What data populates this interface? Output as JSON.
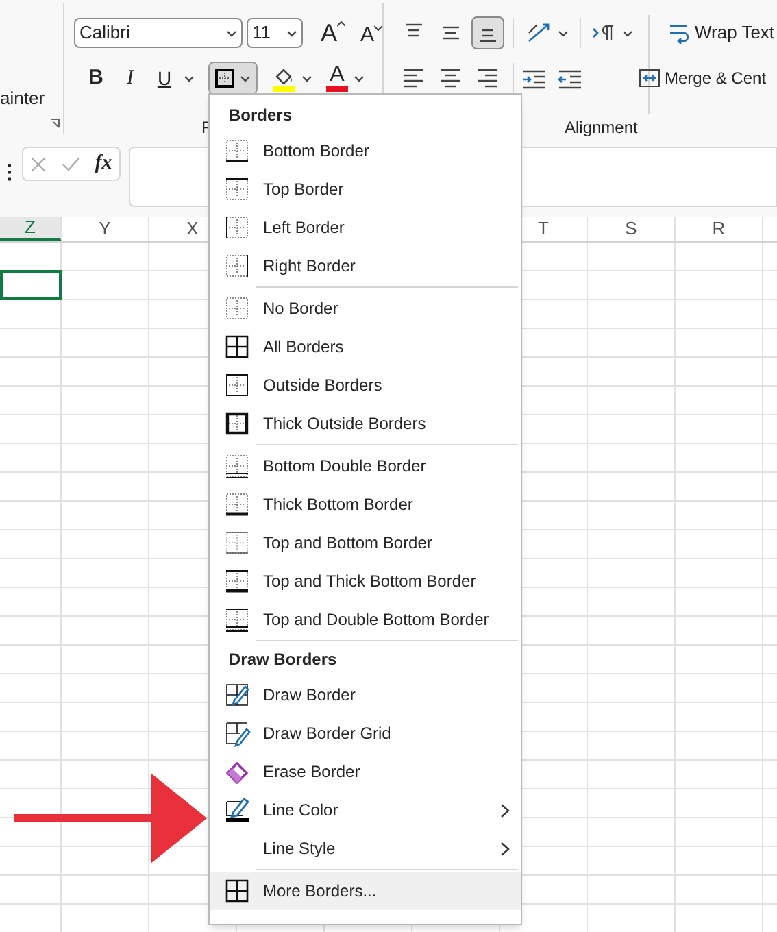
{
  "ribbon": {
    "clipboard_label": "ainter",
    "font": {
      "name": "Calibri",
      "size": "11",
      "grow": "A",
      "shrink": "A",
      "bold": "B",
      "italic": "I",
      "underline": "U",
      "font_color": "A",
      "borders_pressed": true,
      "label": "F"
    },
    "alignment": {
      "vertical": [
        {
          "kind": "top",
          "pressed": false
        },
        {
          "kind": "middle",
          "pressed": false
        },
        {
          "kind": "bottom",
          "pressed": true
        }
      ],
      "horizontal": [
        {
          "kind": "left",
          "pressed": false
        },
        {
          "kind": "center",
          "pressed": false
        },
        {
          "kind": "right",
          "pressed": false
        }
      ],
      "wrap_text": "Wrap Text",
      "merge": "Merge & Cent",
      "label": "Alignment"
    }
  },
  "formula_bar": {
    "more": "⋮",
    "function": "fx"
  },
  "columns_left": [
    {
      "name": "Z",
      "selected": true
    },
    {
      "name": "Y",
      "selected": false
    },
    {
      "name": "X",
      "selected": false
    }
  ],
  "columns_right": [
    {
      "name": "T",
      "selected": false
    },
    {
      "name": "S",
      "selected": false
    },
    {
      "name": "R",
      "selected": false
    }
  ],
  "menu": {
    "sections": [
      {
        "heading": "Borders",
        "items": [
          {
            "kind": "bottom",
            "label": "Bottom Border",
            "submenu": false,
            "highlighted": false
          },
          {
            "kind": "top",
            "label": "Top Border",
            "submenu": false,
            "highlighted": false
          },
          {
            "kind": "left",
            "label": "Left Border",
            "submenu": false,
            "highlighted": false
          },
          {
            "kind": "right",
            "label": "Right Border",
            "submenu": false,
            "highlighted": false
          }
        ]
      },
      {
        "items": [
          {
            "kind": "none",
            "label": "No Border",
            "submenu": false,
            "highlighted": false
          },
          {
            "kind": "all",
            "label": "All Borders",
            "submenu": false,
            "highlighted": false
          },
          {
            "kind": "outside",
            "label": "Outside Borders",
            "submenu": false,
            "highlighted": false
          },
          {
            "kind": "thick_outside",
            "label": "Thick Outside Borders",
            "submenu": false,
            "highlighted": false
          }
        ]
      },
      {
        "items": [
          {
            "kind": "bottom_double",
            "label": "Bottom Double Border",
            "submenu": false,
            "highlighted": false
          },
          {
            "kind": "thick_bottom",
            "label": "Thick Bottom Border",
            "submenu": false,
            "highlighted": false
          },
          {
            "kind": "top_bottom",
            "label": "Top and Bottom Border",
            "submenu": false,
            "highlighted": false
          },
          {
            "kind": "top_thick_bottom",
            "label": "Top and Thick Bottom Border",
            "submenu": false,
            "highlighted": false
          },
          {
            "kind": "top_double_bottom",
            "label": "Top and Double Bottom Border",
            "submenu": false,
            "highlighted": false
          }
        ]
      },
      {
        "heading": "Draw Borders",
        "items": [
          {
            "kind": "draw",
            "label": "Draw Border",
            "submenu": false,
            "highlighted": false
          },
          {
            "kind": "draw_grid",
            "label": "Draw Border Grid",
            "submenu": false,
            "highlighted": false
          },
          {
            "kind": "erase",
            "label": "Erase Border",
            "submenu": false,
            "highlighted": false
          },
          {
            "kind": "line_color",
            "label": "Line Color",
            "submenu": true,
            "highlighted": false
          },
          {
            "kind": "line_style",
            "label": "Line Style",
            "submenu": true,
            "highlighted": false
          }
        ]
      },
      {
        "items": [
          {
            "kind": "more",
            "label": "More Borders...",
            "submenu": false,
            "highlighted": true
          }
        ]
      }
    ]
  }
}
